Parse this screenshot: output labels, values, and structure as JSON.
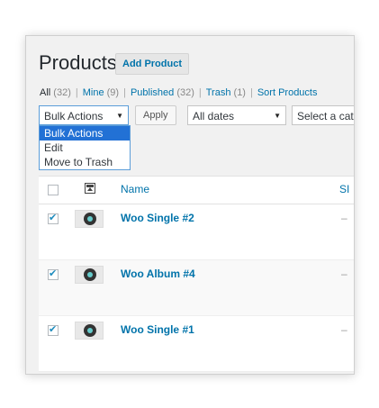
{
  "header": {
    "title": "Products",
    "add_button": "Add Product"
  },
  "filters": {
    "all_label": "All",
    "all_count": "(32)",
    "mine_label": "Mine",
    "mine_count": "(9)",
    "published_label": "Published",
    "published_count": "(32)",
    "trash_label": "Trash",
    "trash_count": "(1)",
    "sort_label": "Sort Products",
    "separator": "|"
  },
  "toolbar": {
    "bulk_actions_value": "Bulk Actions",
    "apply_label": "Apply",
    "dates_value": "All dates",
    "category_value": "Select a cat",
    "caret_icon": "▼"
  },
  "bulk_dropdown": {
    "options": [
      "Bulk Actions",
      "Edit",
      "Move to Trash"
    ],
    "selected_index": 0
  },
  "table": {
    "columns": {
      "name": "Name",
      "sku": "SI"
    },
    "rows": [
      {
        "name": "Woo Single #2",
        "sku": "–",
        "checked": true
      },
      {
        "name": "Woo Album #4",
        "sku": "–",
        "checked": true
      },
      {
        "name": "Woo Single #1",
        "sku": "–",
        "checked": true
      }
    ]
  },
  "colors": {
    "link": "#0073aa",
    "selected_option": "#2271d5",
    "focus_border": "#5b9dd9"
  },
  "icons": {
    "thumbnail_header": "image-icon",
    "caret": "chevron-down-icon",
    "check": "checkmark-icon"
  }
}
